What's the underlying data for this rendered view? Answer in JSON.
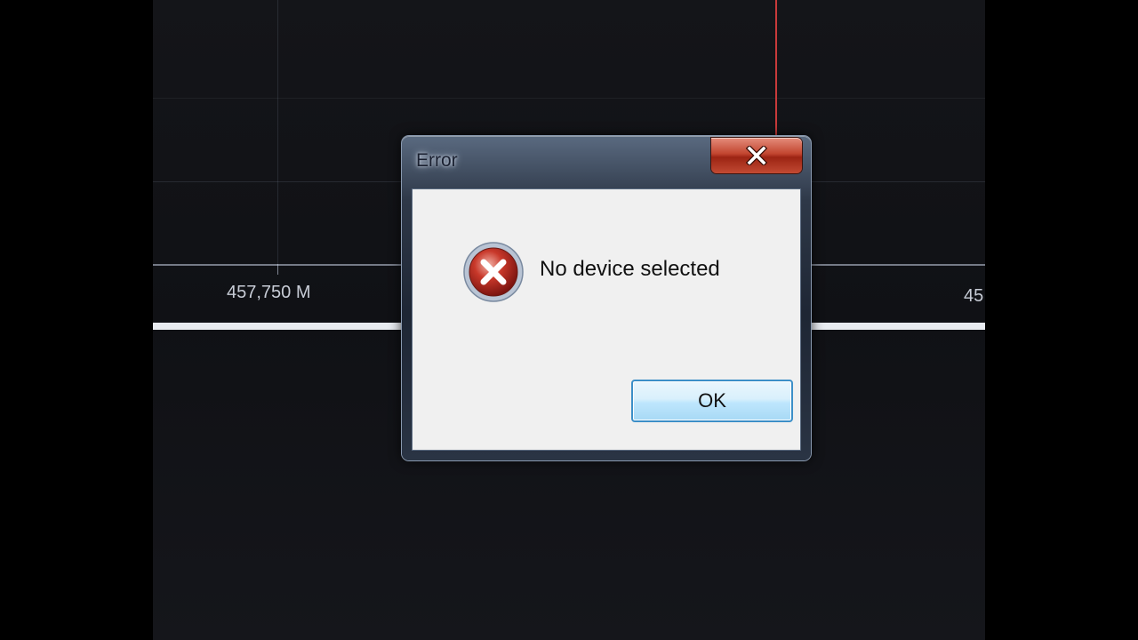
{
  "background_app": {
    "frequency_labels": [
      "457,750 M",
      "45"
    ],
    "marker_color": "#c83a3a"
  },
  "dialog": {
    "title": "Error",
    "icon": "error-icon",
    "message": "No device selected",
    "ok_label": "OK",
    "close_icon": "close-icon"
  }
}
